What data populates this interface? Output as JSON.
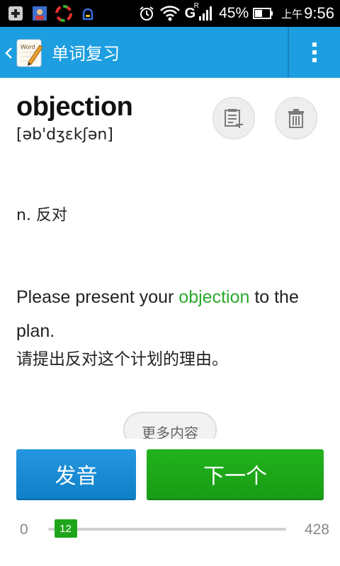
{
  "status_bar": {
    "network_label": "G",
    "roaming_label": "R",
    "battery": "45%",
    "time_prefix": "上午",
    "time": "9:56"
  },
  "action_bar": {
    "title": "单词复习",
    "app_icon_text": "Word"
  },
  "word_card": {
    "word": "objection",
    "phonetic": "[əb'dʒɛkʃən]",
    "meaning": "n. 反对",
    "example_before": "Please present your ",
    "example_highlight": "objection",
    "example_after": " to the plan.",
    "translation": "请提出反对这个计划的理由。",
    "more_label": "更多内容"
  },
  "buttons": {
    "speak_label": "发音",
    "next_label": "下一个"
  },
  "progress": {
    "min_label": "0",
    "max_label": "428",
    "current": 12,
    "max": 428
  },
  "colors": {
    "action_bar": "#1c9ee0",
    "highlight": "#2aaa2a",
    "speak_button": "#1a8bd5",
    "next_button": "#1ea51a"
  }
}
